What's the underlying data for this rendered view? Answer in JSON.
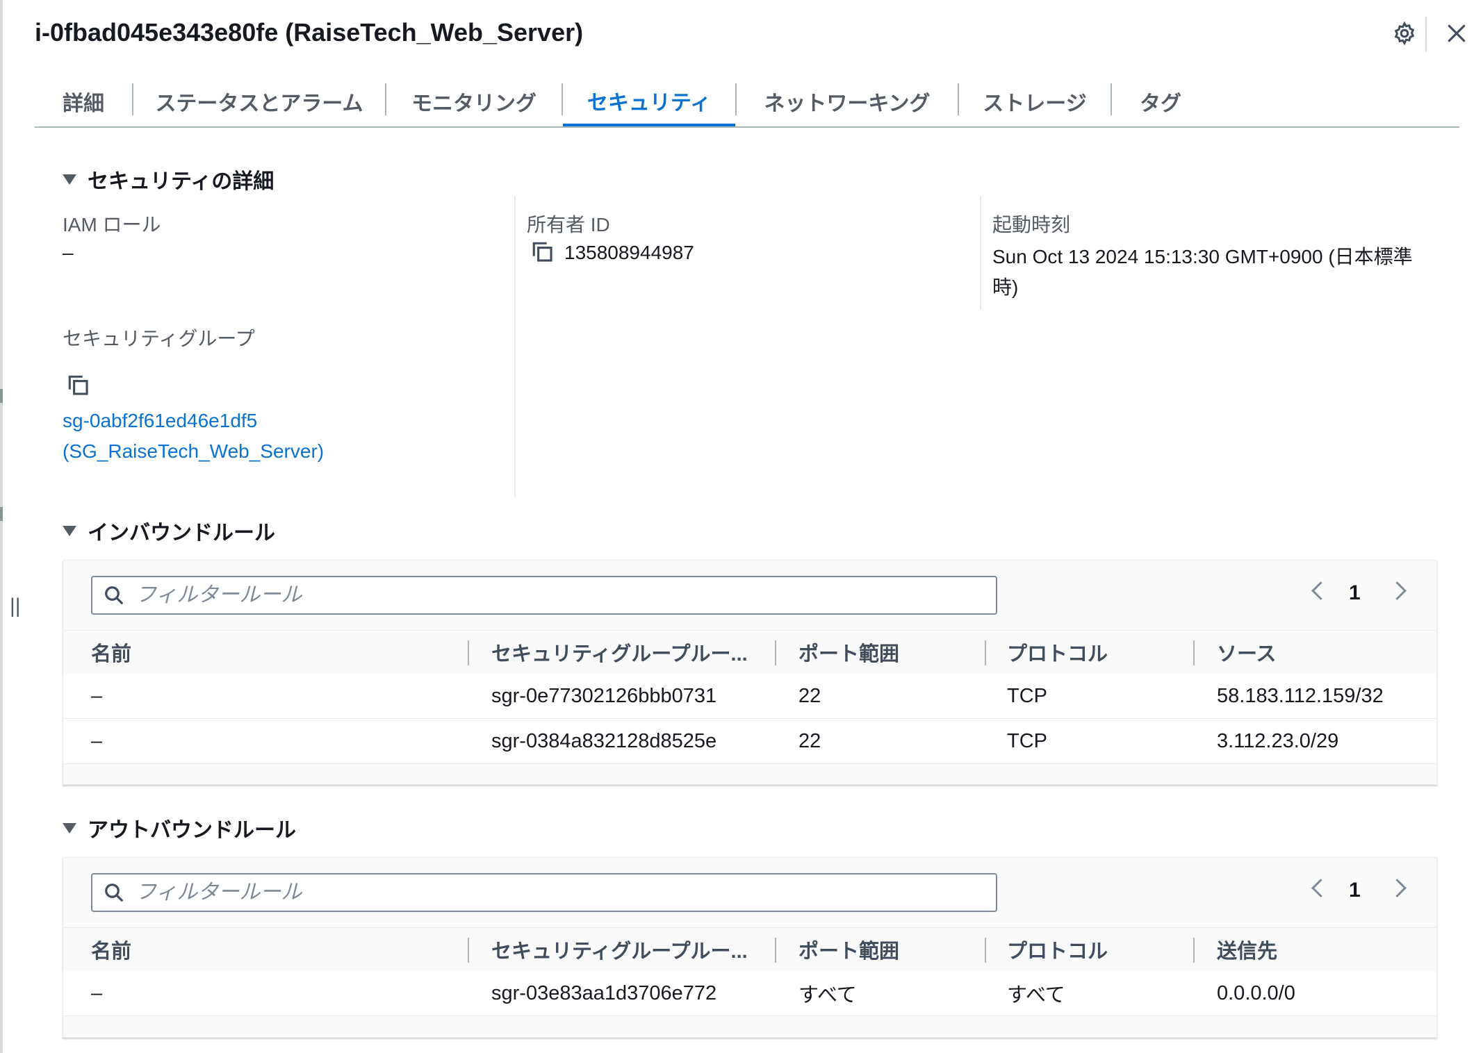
{
  "panel": {
    "title": "i-0fbad045e343e80fe (RaiseTech_Web_Server)"
  },
  "tabs": [
    {
      "label": "詳細"
    },
    {
      "label": "ステータスとアラーム"
    },
    {
      "label": "モニタリング"
    },
    {
      "label": "セキュリティ"
    },
    {
      "label": "ネットワーキング"
    },
    {
      "label": "ストレージ"
    },
    {
      "label": "タグ"
    }
  ],
  "active_tab": "セキュリティ",
  "security_details": {
    "header": "セキュリティの詳細",
    "iam_role_label": "IAM ロール",
    "iam_role_value": "–",
    "owner_id_label": "所有者 ID",
    "owner_id_value": "135808944987",
    "launch_time_label": "起動時刻",
    "launch_time_value_line1": "Sun Oct 13 2024 15:13:30 GMT+0900 (日本標準",
    "launch_time_value_line2": "時)",
    "sg_label": "セキュリティグループ",
    "sg_link_line1": "sg-0abf2f61ed46e1df5",
    "sg_link_line2": "(SG_RaiseTech_Web_Server)"
  },
  "inbound": {
    "header": "インバウンドルール",
    "filter_placeholder": "フィルタールール",
    "page": "1",
    "columns": [
      "名前",
      "セキュリティグループルー...",
      "ポート範囲",
      "プロトコル",
      "ソース"
    ],
    "rows": [
      {
        "name": "–",
        "rule_id": "sgr-0e77302126bbb0731",
        "port": "22",
        "protocol": "TCP",
        "source": "58.183.112.159/32"
      },
      {
        "name": "–",
        "rule_id": "sgr-0384a832128d8525e",
        "port": "22",
        "protocol": "TCP",
        "source": "3.112.23.0/29"
      }
    ]
  },
  "outbound": {
    "header": "アウトバウンドルール",
    "filter_placeholder": "フィルタールール",
    "page": "1",
    "columns": [
      "名前",
      "セキュリティグループルー...",
      "ポート範囲",
      "プロトコル",
      "送信先"
    ],
    "rows": [
      {
        "name": "–",
        "rule_id": "sgr-03e83aa1d3706e772",
        "port": "すべて",
        "protocol": "すべて",
        "destination": "0.0.0.0/0"
      }
    ]
  },
  "colors": {
    "accent": "#0972d3",
    "text": "#16191f",
    "muted": "#545b64"
  }
}
